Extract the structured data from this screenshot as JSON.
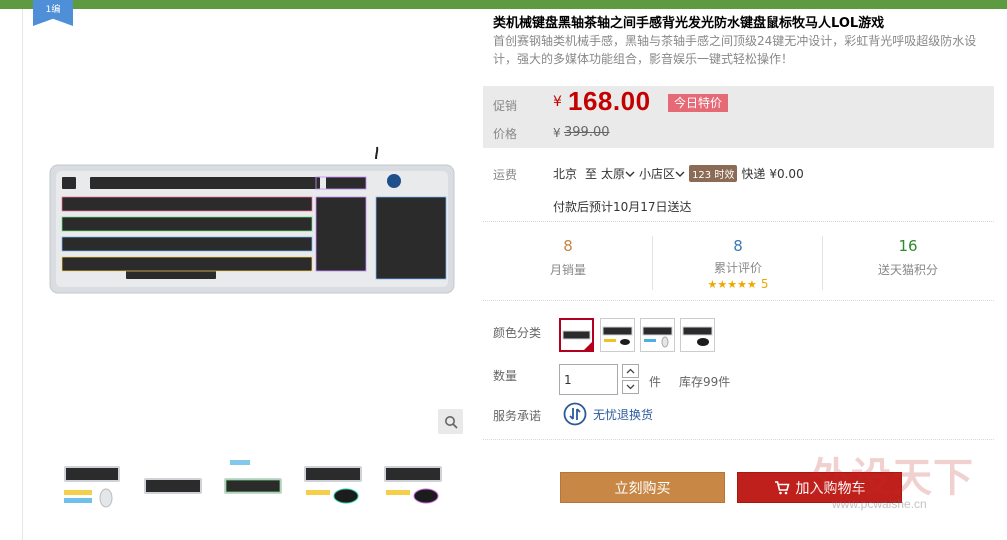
{
  "topbar": {
    "badge_text": "1编"
  },
  "product": {
    "title": "类机械键盘黑轴茶轴之间手感背光发光防水键盘鼠标牧马人LOL游戏",
    "subtitle": "首创赛钢轴类机械手感，黑轴与茶轴手感之间顶级24键无冲设计，彩虹背光呼吸超级防水设计，强大的多媒体功能组合，影音娱乐一键式轻松操作！"
  },
  "price": {
    "promo_label": "促销",
    "currency": "¥",
    "promo_price": "168.00",
    "promo_badge": "今日特价",
    "price_label": "价格",
    "original_price": "399.00"
  },
  "shipping": {
    "label": "运费",
    "from": "北京",
    "to_word": "至",
    "to_city": "太原",
    "to_area": "小店区",
    "badge": "123 时效",
    "method": "快递",
    "fee": "¥0.00",
    "eta": "付款后预计10月17日送达"
  },
  "stats": [
    {
      "value": "8",
      "label": "月销量",
      "color": "#c98745"
    },
    {
      "value": "8",
      "label": "累计评价",
      "color": "#3a7ab8",
      "stars": "★★★★★",
      "star_count": "5"
    },
    {
      "value": "16",
      "label": "送天猫积分",
      "color": "#2e8b2e"
    }
  ],
  "color_option": {
    "label": "颜色分类",
    "selected_index": 0,
    "swatch_count": 4
  },
  "quantity": {
    "label": "数量",
    "value": "1",
    "unit": "件",
    "stock": "库存99件"
  },
  "service": {
    "label": "服务承诺",
    "text": "无忧退换货"
  },
  "actions": {
    "buy_now": "立刻购买",
    "add_to_cart": "加入购物车"
  },
  "watermark": {
    "big": "外设天下",
    "small": "www.pcwaishe.cn"
  },
  "colors": {
    "accent_red": "#c40000",
    "buy_btn": "#c98745",
    "cart_btn": "#c0201b"
  },
  "icons": {
    "zoom": "magnifier-icon",
    "cart": "cart-icon",
    "service": "return-icon"
  }
}
